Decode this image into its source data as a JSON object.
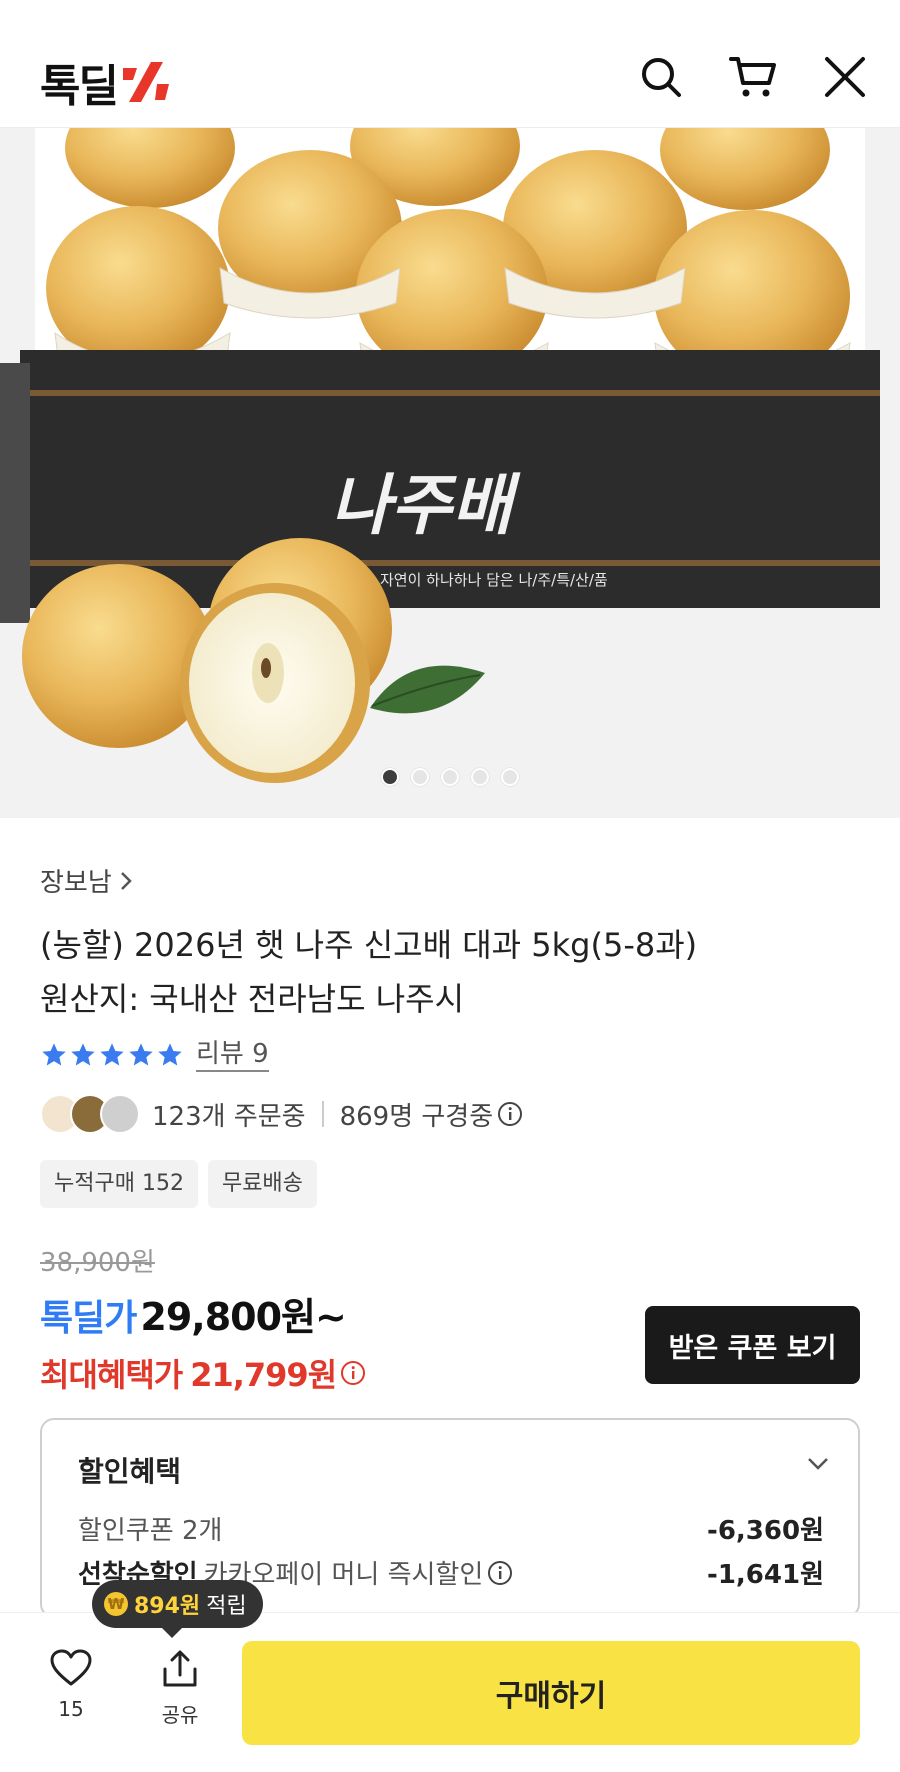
{
  "header": {
    "logo_text": "톡딜",
    "icons": [
      "search-icon",
      "cart-icon",
      "close-icon"
    ]
  },
  "hero": {
    "box_text": "나주배",
    "box_subtext": "자연이 하나하나 담은 나/주/특/산/품",
    "slide_count": 5,
    "active_slide": 1
  },
  "product": {
    "seller": "장보남",
    "title_line1": "(농할) 2026년 햇 나주 신고배 대과 5kg(5-8과)",
    "title_line2": "원산지: 국내산 전라남도 나주시",
    "rating_stars": 5,
    "review_label": "리뷰 9",
    "ordering_text": "123개 주문중",
    "viewing_text": "869명 구경중",
    "chips": [
      "누적구매 152",
      "무료배송"
    ]
  },
  "price": {
    "original": "38,900원",
    "deal_label": "톡딜가",
    "deal_price": "29,800원~",
    "max_label": "최대혜택가",
    "max_price": "21,799원",
    "coupon_button": "받은 쿠폰 보기"
  },
  "discount": {
    "title": "할인혜택",
    "rows": [
      {
        "label_bold": "",
        "label": "할인쿠폰 2개",
        "amount": "-6,360원"
      },
      {
        "label_bold": "선착순할인",
        "label": "카카오페이 머니 즉시할인",
        "amount": "-1,641원"
      }
    ]
  },
  "bottom": {
    "like_count": "15",
    "share_label": "공유",
    "buy_label": "구매하기",
    "point_coin": "₩",
    "point_amount": "894원",
    "point_suffix": "적립"
  },
  "colors": {
    "deal_blue": "#2f7cf6",
    "max_red": "#e0382b",
    "buy_yellow": "#f9e243",
    "logo_red": "#e8362a"
  }
}
